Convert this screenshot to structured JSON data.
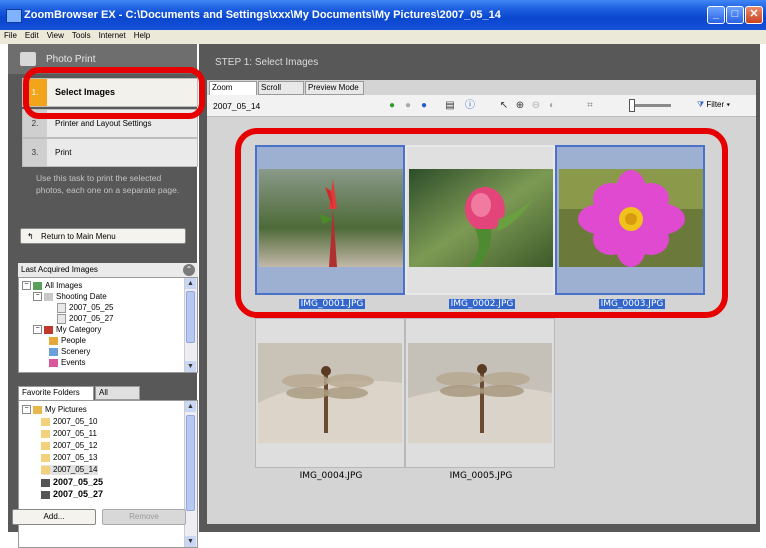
{
  "window": {
    "title": "ZoomBrowser EX  -  C:\\Documents and Settings\\xxx\\My Documents\\My Pictures\\2007_05_14"
  },
  "menu": [
    "File",
    "Edit",
    "View",
    "Tools",
    "Internet",
    "Help"
  ],
  "left_panel": {
    "header": "Photo Print",
    "steps": [
      {
        "num": "1.",
        "label": "Select Images"
      },
      {
        "num": "2.",
        "label": "Printer and Layout Settings"
      },
      {
        "num": "3.",
        "label": "Print"
      }
    ],
    "description": "Use this task to print the selected photos, each one on a separate page.",
    "return_label": "Return to Main Menu",
    "last_acquired_title": "Last Acquired Images",
    "last_acquired_tree": [
      "All Images",
      "Shooting Date",
      "2007_05_25",
      "2007_05_27",
      "My Category",
      "People",
      "Scenery",
      "Events"
    ],
    "folder_tabs": [
      "Favorite Folders",
      "All Folders"
    ],
    "folder_tree": [
      "My Pictures",
      "2007_05_10",
      "2007_05_11",
      "2007_05_12",
      "2007_05_13",
      "2007_05_14",
      "2007_05_25",
      "2007_05_27"
    ],
    "add_label": "Add...",
    "remove_label": "Remove"
  },
  "right_panel": {
    "step_title": "STEP 1: Select Images",
    "view_tabs": [
      "Zoom Mode",
      "Scroll Mode",
      "Preview Mode"
    ],
    "current_folder": "2007_05_14",
    "filter_label": "Filter",
    "thumbnails": [
      {
        "name": "IMG_0001.JPG",
        "selected": true
      },
      {
        "name": "IMG_0002.JPG",
        "selected": true
      },
      {
        "name": "IMG_0003.JPG",
        "selected": true
      },
      {
        "name": "IMG_0004.JPG",
        "selected": false
      },
      {
        "name": "IMG_0005.JPG",
        "selected": false
      }
    ]
  },
  "colors": {
    "highlight": "#e60000",
    "selection": "#3266cc",
    "step_active": "#f2a51a"
  }
}
